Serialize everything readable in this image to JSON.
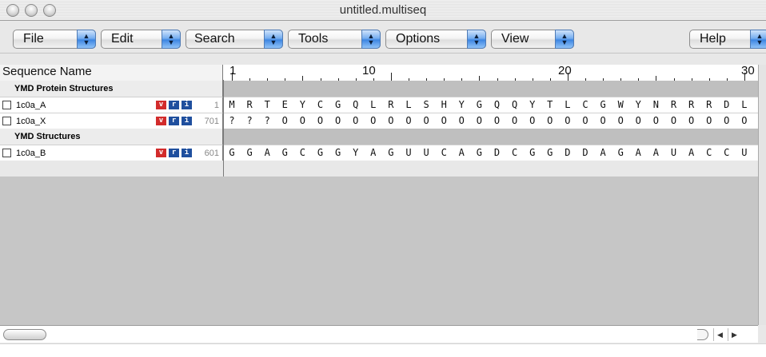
{
  "window": {
    "title": "untitled.multiseq"
  },
  "menus": [
    {
      "label": "File"
    },
    {
      "label": "Edit"
    },
    {
      "label": "Search"
    },
    {
      "label": "Tools"
    },
    {
      "label": "Options"
    },
    {
      "label": "View"
    },
    {
      "label": "Help"
    }
  ],
  "header": {
    "name_column": "Sequence Name",
    "ruler_labels": [
      "1",
      "10",
      "20",
      "30"
    ]
  },
  "groups": [
    {
      "label": "YMD Protein Structures",
      "sequences": [
        {
          "name": "1c0a_A",
          "badges": [
            "v",
            "r",
            "i"
          ],
          "start": "1",
          "residues": [
            "M",
            "R",
            "T",
            "E",
            "Y",
            "C",
            "G",
            "Q",
            "L",
            "R",
            "L",
            "S",
            "H",
            "Y",
            "G",
            "Q",
            "Q",
            "Y",
            "T",
            "L",
            "C",
            "G",
            "W",
            "Y",
            "N",
            "R",
            "R",
            "R",
            "D",
            "L"
          ]
        },
        {
          "name": "1c0a_X",
          "badges": [
            "v",
            "r",
            "i"
          ],
          "start": "701",
          "residues": [
            "?",
            "?",
            "?",
            "O",
            "O",
            "O",
            "O",
            "O",
            "O",
            "O",
            "O",
            "O",
            "O",
            "O",
            "O",
            "O",
            "O",
            "O",
            "O",
            "O",
            "O",
            "O",
            "O",
            "O",
            "O",
            "O",
            "O",
            "O",
            "O",
            "O"
          ]
        }
      ]
    },
    {
      "label": "YMD Structures",
      "sequences": [
        {
          "name": "1c0a_B",
          "badges": [
            "v",
            "r",
            "i"
          ],
          "start": "601",
          "residues": [
            "G",
            "G",
            "A",
            "G",
            "C",
            "G",
            "G",
            "Y",
            "A",
            "G",
            "U",
            "U",
            "C",
            "A",
            "G",
            "D",
            "C",
            "G",
            "G",
            "D",
            "D",
            "A",
            "G",
            "A",
            "A",
            "U",
            "A",
            "C",
            "C",
            "U"
          ]
        }
      ]
    }
  ],
  "colors": {
    "badge_v": "#d22b2b",
    "badge_ri": "#1f4f9e",
    "popup_arrow": "#3d86e2",
    "empty_area": "#c6c6c6"
  }
}
